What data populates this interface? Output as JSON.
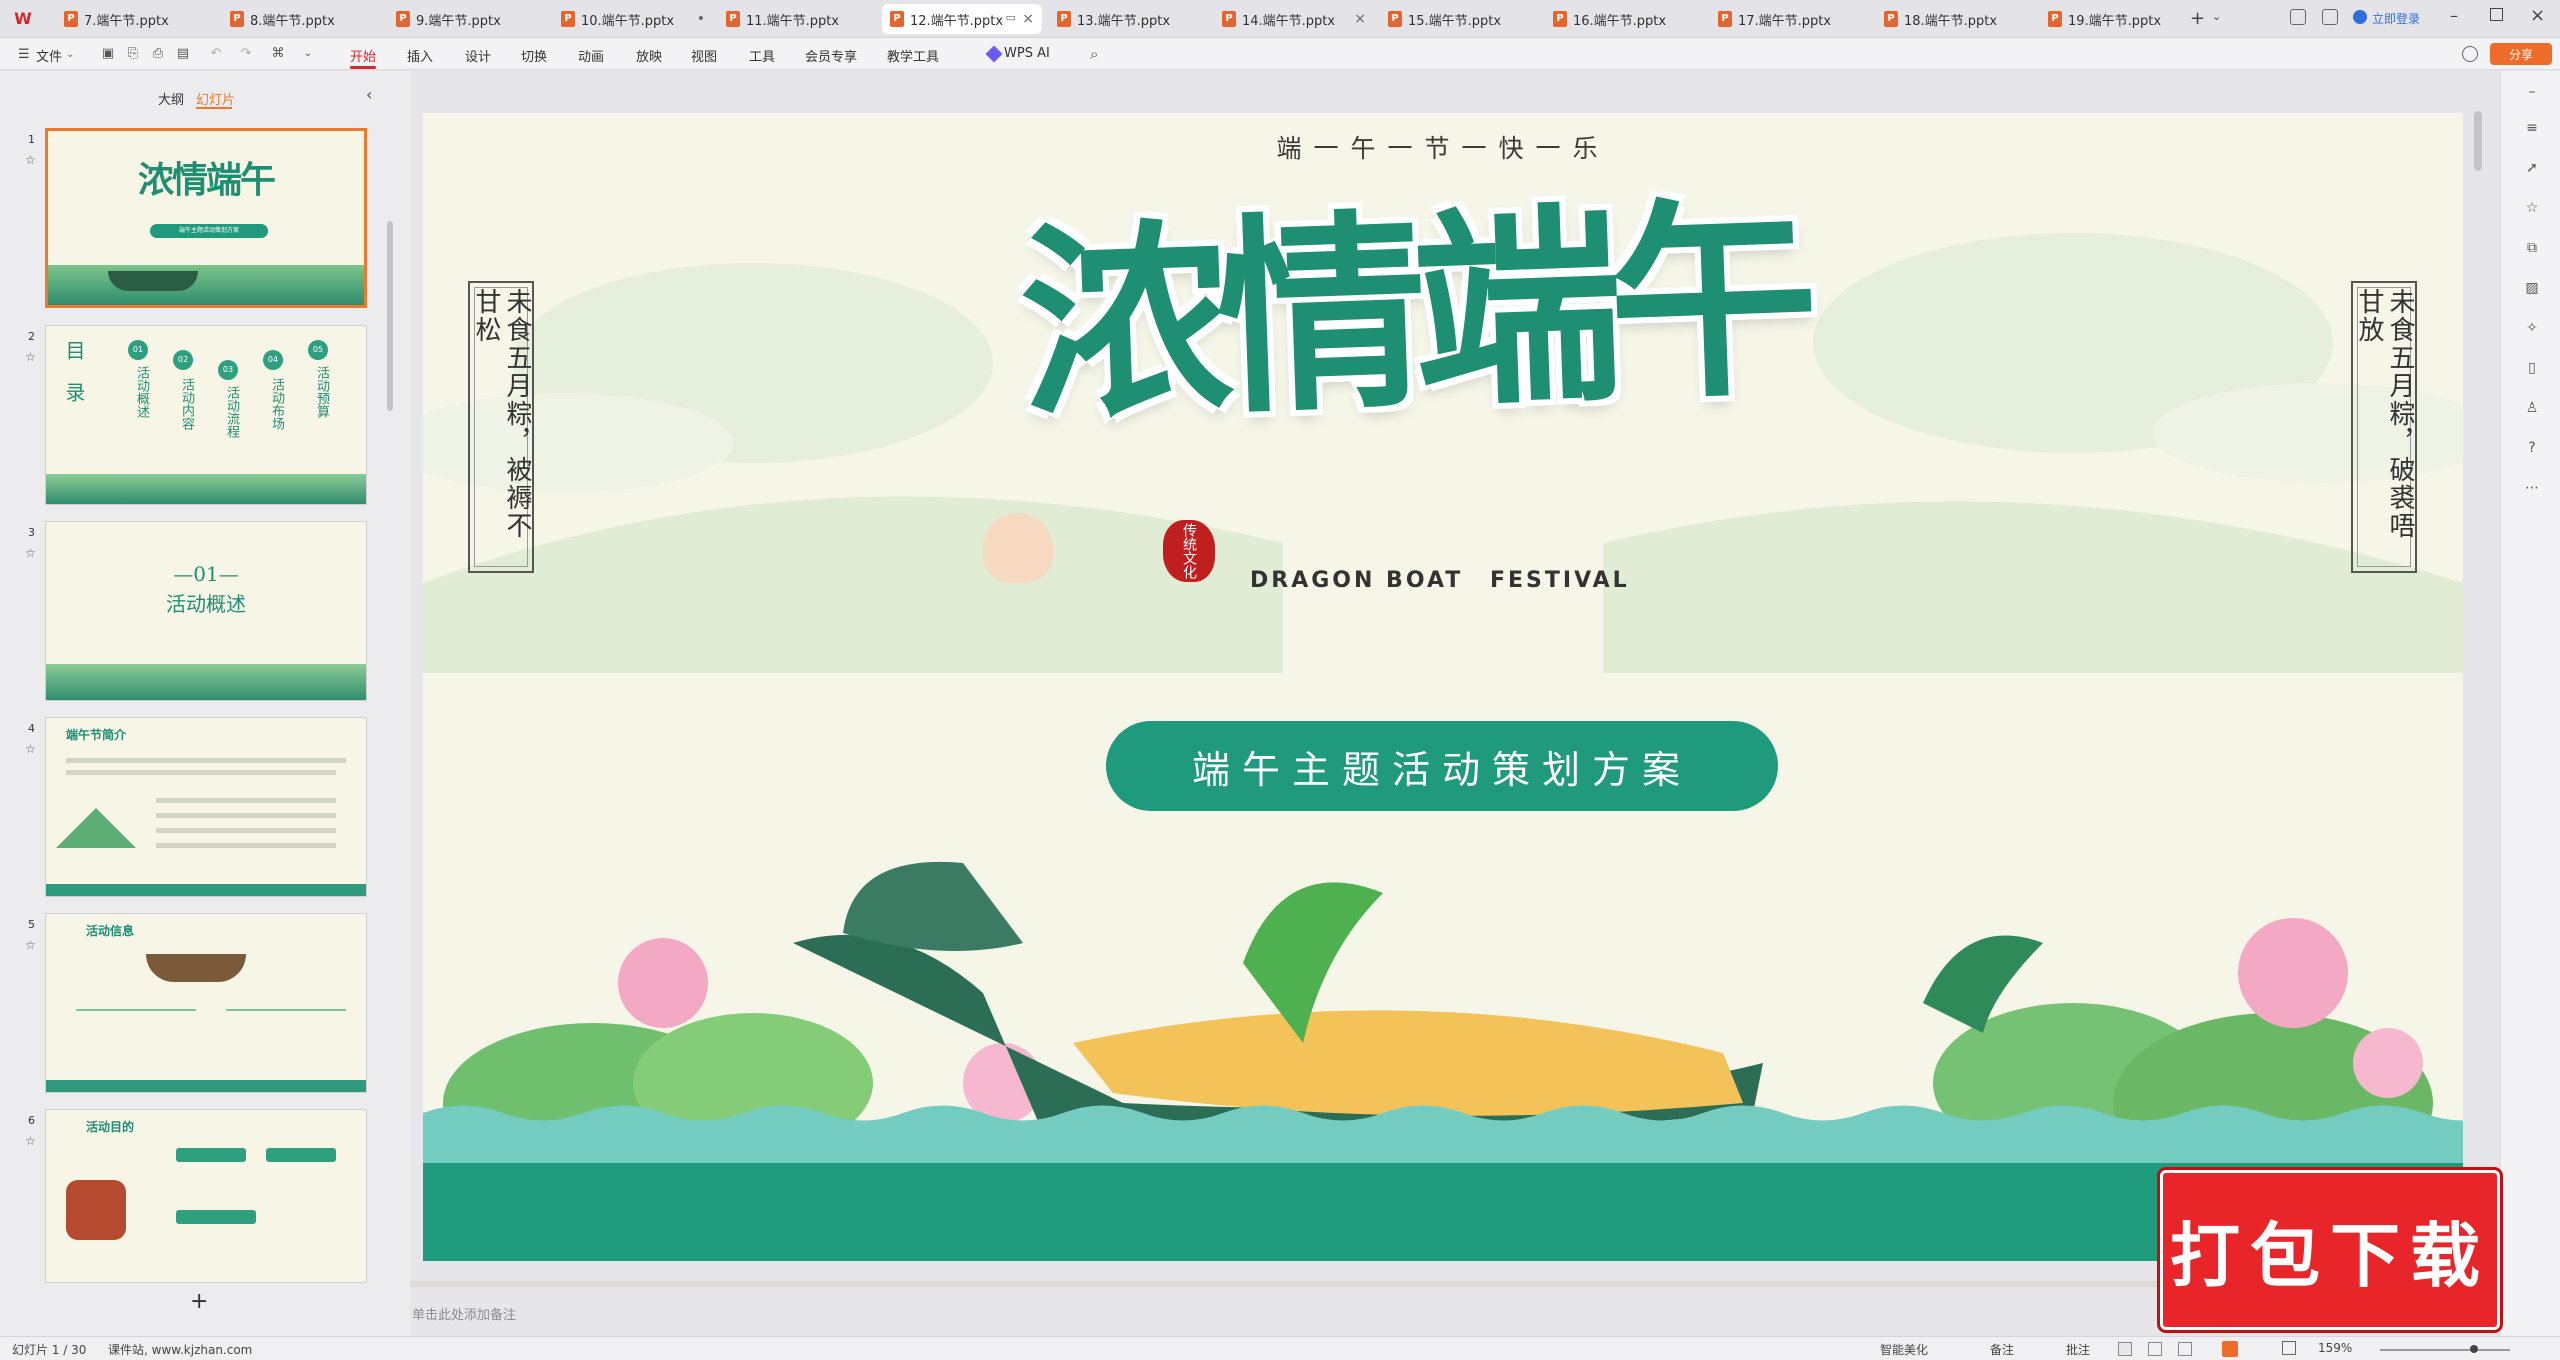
{
  "tabs": [
    {
      "label": "7.端午节.pptx",
      "active": false
    },
    {
      "label": "8.端午节.pptx",
      "active": false
    },
    {
      "label": "9.端午节.pptx",
      "active": false
    },
    {
      "label": "10.端午节.pptx",
      "active": false
    },
    {
      "label": "11.端午节.pptx",
      "active": false
    },
    {
      "label": "12.端午节.pptx",
      "active": true
    },
    {
      "label": "13.端午节.pptx",
      "active": false
    },
    {
      "label": "14.端午节.pptx",
      "active": false
    },
    {
      "label": "15.端午节.pptx",
      "active": false
    },
    {
      "label": "16.端午节.pptx",
      "active": false
    },
    {
      "label": "17.端午节.pptx",
      "active": false
    },
    {
      "label": "18.端午节.pptx",
      "active": false
    },
    {
      "label": "19.端午节.pptx",
      "active": false
    }
  ],
  "titlebar": {
    "login": "立即登录",
    "share": "分享"
  },
  "menu": {
    "file": "文件",
    "items": [
      "开始",
      "插入",
      "设计",
      "切换",
      "动画",
      "放映",
      "视图",
      "工具",
      "会员专享",
      "教学工具",
      "WPS AI"
    ],
    "active": "开始"
  },
  "panel": {
    "tab_outline": "大纲",
    "tab_slides": "幻灯片",
    "add": "+",
    "thumbs": [
      {
        "num": "1",
        "title": "浓情端午",
        "sub": "端午主题活动策划方案"
      },
      {
        "num": "2",
        "title": "目录",
        "items": [
          "活动概述",
          "活动内容",
          "活动流程",
          "活动布场",
          "活动预算"
        ],
        "nums": [
          "01",
          "02",
          "03",
          "04",
          "05"
        ]
      },
      {
        "num": "3",
        "title": "—01—",
        "sub": "活动概述"
      },
      {
        "num": "4",
        "title": "端午节简介"
      },
      {
        "num": "5",
        "title": "活动信息"
      },
      {
        "num": "6",
        "title": "活动目的"
      }
    ]
  },
  "slide": {
    "motto": "端一午一节一快一乐",
    "left_poem": "未食五月粽，被褥不甘松",
    "right_poem": "未食五月粽，破裘唔甘放",
    "main_title": "浓情端午",
    "en_left": "DRAGON BOAT",
    "en_right": "FESTIVAL",
    "seal": "传统文化",
    "subtitle": "端午主题活动策划方案"
  },
  "notes_placeholder": "单击此处添加备注",
  "watermark": "打包下载",
  "status": {
    "slide_info": "幻灯片 1 / 30",
    "site": "课件站, www.kjzhan.com",
    "smart": "智能美化",
    "notes": "备注",
    "comments": "批注",
    "zoom": "159%"
  },
  "colors": {
    "accent": "#d9262c",
    "teal": "#1f9a7d",
    "slide_bg": "#f5f6e8",
    "selected_thumb": "#f0782c"
  }
}
